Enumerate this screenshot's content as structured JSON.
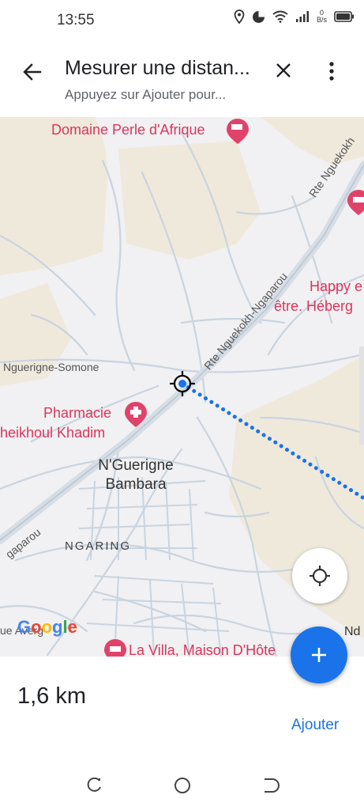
{
  "status": {
    "time": "13:55",
    "net_speed_value": "0",
    "net_speed_unit": "B/s"
  },
  "header": {
    "title": "Mesurer une distan...",
    "subtitle": "Appuyez sur Ajouter pour..."
  },
  "map": {
    "labels": {
      "domaine": "Domaine Perle d'Afrique",
      "rte_top": "Rte Nguekokh",
      "rte_main": "Rte Nguekokh-Ngaparou",
      "happy_1": "Happy e",
      "happy_2": "être. Héberg",
      "nguerigne_somone": "Nguerigne-Somone",
      "pharmacie_1": "Pharmacie",
      "pharmacie_2": "heikhoul Khadim",
      "town_1": "N'Guerigne",
      "town_2": "Bambara",
      "ngaparou": "gaparou",
      "ngaring": "NGARING",
      "averg": "ue Averg",
      "la_villa": "La Villa, Maison D'Hôte",
      "nd": "Nd"
    },
    "google_logo": [
      "G",
      "o",
      "o",
      "g",
      "l",
      "e"
    ],
    "logo_colors": [
      "#4285F4",
      "#EA4335",
      "#FBBC05",
      "#4285F4",
      "#34A853",
      "#EA4335"
    ]
  },
  "panel": {
    "distance": "1,6 km",
    "add_label": "Ajouter"
  },
  "colors": {
    "accent": "#1a73e8",
    "poi": "#d9365c",
    "measure_line": "#1a73e8"
  }
}
